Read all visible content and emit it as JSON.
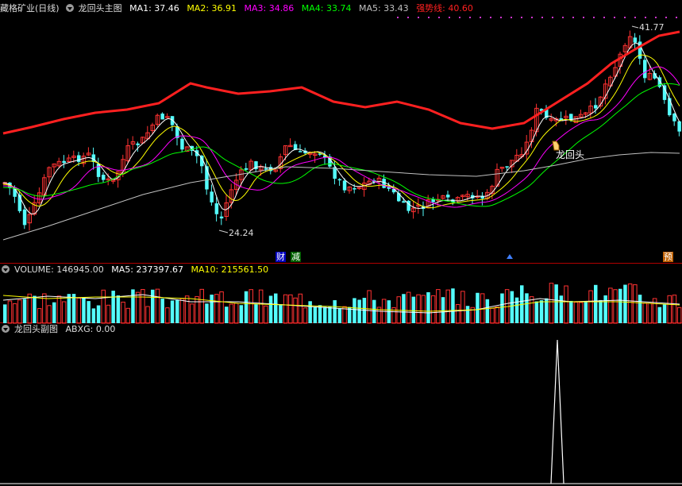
{
  "main_panel": {
    "stock_name": "藏格矿业(日线)",
    "indicator_name": "龙回头主图",
    "ma1": {
      "label": "MA1: 37.46",
      "color": "#ffffff"
    },
    "ma2": {
      "label": "MA2: 36.91",
      "color": "#ffff00"
    },
    "ma3": {
      "label": "MA3: 34.86",
      "color": "#ff00ff"
    },
    "ma4": {
      "label": "MA4: 33.74",
      "color": "#00ff00"
    },
    "ma5": {
      "label": "MA5: 33.43",
      "color": "#c0c0c0"
    },
    "trend": {
      "label": "强势线: 40.60",
      "color": "#ff2020"
    },
    "high_label": "41.77",
    "low_label": "24.24",
    "signal_label": "龙回头",
    "event_marks": [
      {
        "text": "财",
        "bg": "#0000c0",
        "color": "#ffffff"
      },
      {
        "text": "减",
        "bg": "#006000",
        "color": "#ffffff"
      },
      {
        "text": "预",
        "bg": "#c06000",
        "color": "#ffffff"
      }
    ]
  },
  "volume_panel": {
    "title": "VOLUME: 146945.00",
    "ma5": {
      "label": "MA5: 237397.67",
      "color": "#ffffff"
    },
    "ma10": {
      "label": "MA10: 215561.50",
      "color": "#ffff00"
    }
  },
  "sub_panel": {
    "title": "龙回头副图",
    "abxg": {
      "label": "ABXG: 0.00",
      "color": "#ffffff"
    }
  },
  "colors": {
    "up": "#ff3232",
    "down": "#54fcfc",
    "grid": "#b00000"
  }
}
